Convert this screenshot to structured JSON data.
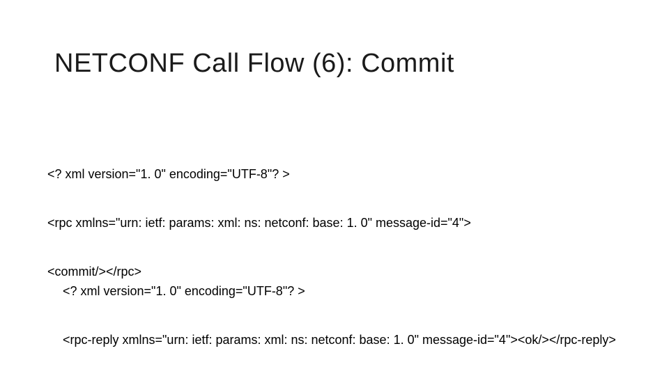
{
  "title": "NETCONF Call Flow (6): Commit",
  "request": {
    "line1": "<? xml version=\"1. 0\" encoding=\"UTF-8\"? >",
    "line2": "<rpc xmlns=\"urn: ietf: params: xml: ns: netconf: base: 1. 0\" message-id=\"4\">",
    "line3": "<commit/></rpc>"
  },
  "reply": {
    "line1": "<? xml version=\"1. 0\" encoding=\"UTF-8\"? >",
    "line2": "<rpc-reply xmlns=\"urn: ietf: params: xml: ns: netconf: base: 1. 0\" message-id=\"4\"><ok/></rpc-reply>"
  }
}
